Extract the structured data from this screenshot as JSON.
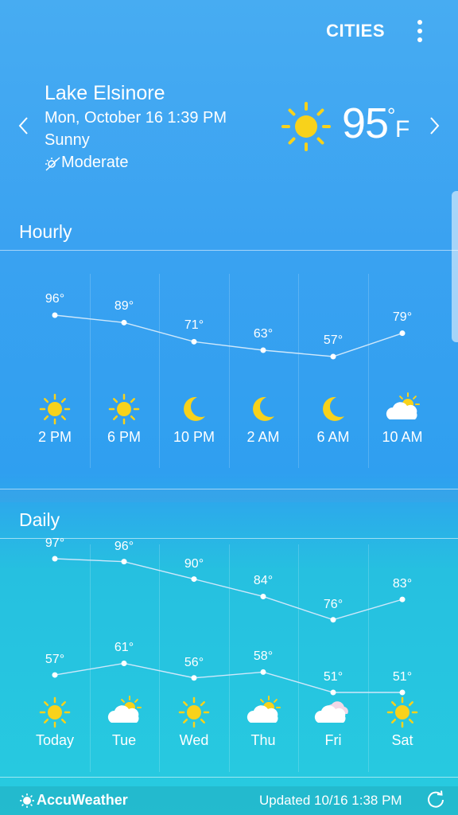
{
  "toolbar": {
    "cities_label": "CITIES",
    "more_icon": "more-vert-icon"
  },
  "current": {
    "city": "Lake Elsinore",
    "datetime": "Mon, October 16 1:39 PM",
    "condition": "Sunny",
    "uv_label": "Moderate",
    "uv_icon": "uv-index-icon",
    "temperature": "95",
    "degree_symbol": "°",
    "unit": "F",
    "icon": "sun-icon"
  },
  "hourly": {
    "title": "Hourly",
    "items": [
      {
        "time": "2 PM",
        "temp": "96°",
        "value": 96,
        "icon": "sun"
      },
      {
        "time": "6 PM",
        "temp": "89°",
        "value": 89,
        "icon": "sun"
      },
      {
        "time": "10 PM",
        "temp": "71°",
        "value": 71,
        "icon": "moon"
      },
      {
        "time": "2 AM",
        "temp": "63°",
        "value": 63,
        "icon": "moon"
      },
      {
        "time": "6 AM",
        "temp": "57°",
        "value": 57,
        "icon": "moon"
      },
      {
        "time": "10 AM",
        "temp": "79°",
        "value": 79,
        "icon": "partly-cloudy"
      }
    ]
  },
  "daily": {
    "title": "Daily",
    "items": [
      {
        "day": "Today",
        "high": "97°",
        "high_value": 97,
        "low": "57°",
        "low_value": 57,
        "icon": "sun"
      },
      {
        "day": "Tue",
        "high": "96°",
        "high_value": 96,
        "low": "61°",
        "low_value": 61,
        "icon": "partly-cloudy"
      },
      {
        "day": "Wed",
        "high": "90°",
        "high_value": 90,
        "low": "56°",
        "low_value": 56,
        "icon": "sun"
      },
      {
        "day": "Thu",
        "high": "84°",
        "high_value": 84,
        "low": "58°",
        "low_value": 58,
        "icon": "partly-cloudy"
      },
      {
        "day": "Fri",
        "high": "76°",
        "high_value": 76,
        "low": "51°",
        "low_value": 51,
        "icon": "cloudy"
      },
      {
        "day": "Sat",
        "high": "83°",
        "high_value": 83,
        "low": "51°",
        "low_value": 51,
        "icon": "sun"
      }
    ]
  },
  "footer": {
    "brand": "AccuWeather",
    "updated": "Updated 10/16  1:38 PM",
    "refresh_icon": "refresh-icon"
  },
  "colors": {
    "sun": "#f8d21b",
    "moon": "#f8d21b",
    "line": "#cfe8fb",
    "cloud": "#ffffff"
  }
}
